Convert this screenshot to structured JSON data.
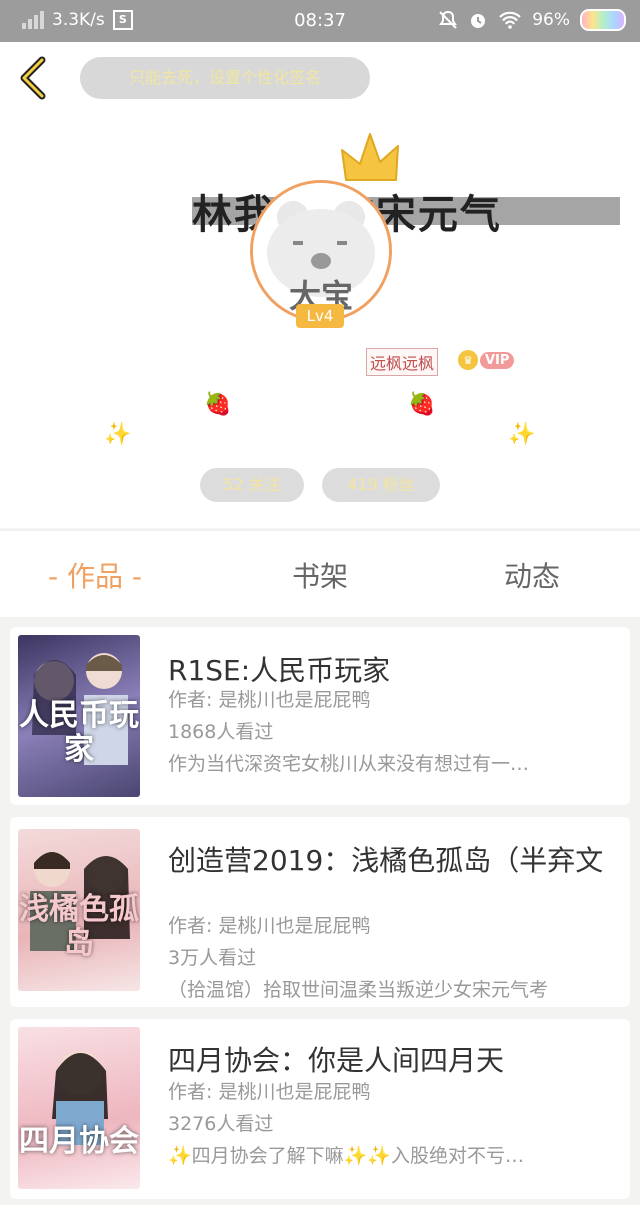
{
  "status_bar": {
    "network_speed": "3.3K/s",
    "s_icon": "S",
    "time": "08:37",
    "battery": "96%"
  },
  "profile": {
    "signature_placeholder": "只能去死，设置个性化签名",
    "name_art": "林我  喜欢宋元气",
    "avatar_text": "大宝",
    "level": "Lv4",
    "nickname": "远枫远枫",
    "vip": "VIP",
    "following": "52 关注",
    "followers": "419 粉丝"
  },
  "tabs": [
    {
      "label": "- 作品 -",
      "active": true
    },
    {
      "label": "书架",
      "active": false
    },
    {
      "label": "动态",
      "active": false
    }
  ],
  "works": [
    {
      "title": "R1SE:人民币玩家",
      "author": "作者: 是桃川也是屁屁鸭",
      "views": "1868人看过",
      "summary": "作为当代深资宅女桃川从来没有想过有一…",
      "cover_text": "人民币玩家"
    },
    {
      "title": "创造营2019：浅橘色孤岛（半弃文",
      "author": "作者: 是桃川也是屁屁鸭",
      "views": "3万人看过",
      "summary": "（拾温馆）拾取世间温柔当叛逆少女宋元气考",
      "cover_text": "浅橘色孤岛"
    },
    {
      "title": "四月协会：你是人间四月天",
      "author": "作者: 是桃川也是屁屁鸭",
      "views": "3276人看过",
      "summary": "✨四月协会了解下嘛✨✨入股绝对不亏…",
      "cover_text": "四月协会"
    }
  ],
  "colors": {
    "accent": "#f0a060",
    "status_bar": "#9c9c9c",
    "level_badge": "#f5b942"
  }
}
